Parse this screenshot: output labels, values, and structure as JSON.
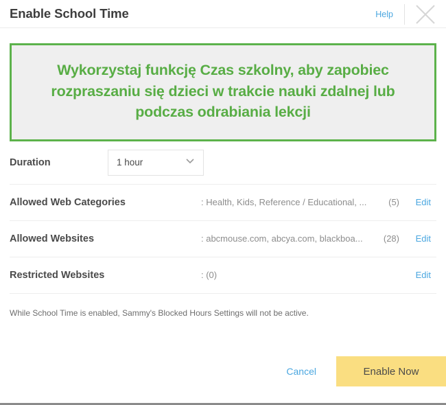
{
  "header": {
    "title": "Enable School Time",
    "help_label": "Help",
    "close_icon": "close-icon"
  },
  "banner": {
    "text": "Wykorzystaj funkcję Czas szkolny, aby zapobiec rozpraszaniu się dzieci w trakcie nauki zdalnej lub podczas odrabiania lekcji",
    "border_color": "#5cb24b",
    "text_color": "#58ad45",
    "background_color": "#efefef"
  },
  "duration": {
    "label": "Duration",
    "selected": "1 hour",
    "chevron_icon": "chevron-down-icon"
  },
  "settings": [
    {
      "label": "Allowed Web Categories",
      "value": ": Health, Kids, Reference / Educational, ...",
      "count": "(5)",
      "edit_label": "Edit"
    },
    {
      "label": "Allowed Websites",
      "value": ": abcmouse.com, abcya.com, blackboa...",
      "count": "(28)",
      "edit_label": "Edit"
    },
    {
      "label": "Restricted Websites",
      "value": ": (0)",
      "count": "",
      "edit_label": "Edit"
    }
  ],
  "note": "While School Time is enabled, Sammy's Blocked Hours Settings will not be active.",
  "footer": {
    "cancel_label": "Cancel",
    "enable_label": "Enable Now",
    "enable_color": "#fade81"
  }
}
